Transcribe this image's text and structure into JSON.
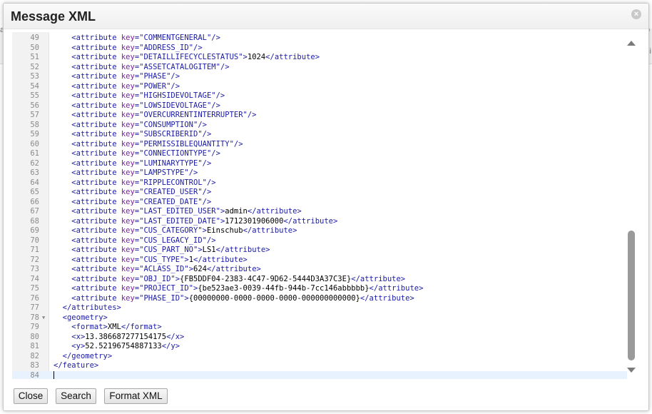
{
  "background": {
    "edge_left": "a",
    "edge_right_top": "o",
    "edge_right_bottom": "si"
  },
  "dialog": {
    "title": "Message XML",
    "close_glyph": "×"
  },
  "lines": [
    {
      "n": "49",
      "indent": "    ",
      "key": "COMMENTGENERAL",
      "value": null
    },
    {
      "n": "50",
      "indent": "    ",
      "key": "ADDRESS_ID",
      "value": null
    },
    {
      "n": "51",
      "indent": "    ",
      "key": "DETAILLIFECYCLESTATUS",
      "value": "1024"
    },
    {
      "n": "52",
      "indent": "    ",
      "key": "ASSETCATALOGITEM",
      "value": null
    },
    {
      "n": "53",
      "indent": "    ",
      "key": "PHASE",
      "value": null
    },
    {
      "n": "54",
      "indent": "    ",
      "key": "POWER",
      "value": null
    },
    {
      "n": "55",
      "indent": "    ",
      "key": "HIGHSIDEVOLTAGE",
      "value": null
    },
    {
      "n": "56",
      "indent": "    ",
      "key": "LOWSIDEVOLTAGE",
      "value": null
    },
    {
      "n": "57",
      "indent": "    ",
      "key": "OVERCURRENTINTERRUPTER",
      "value": null
    },
    {
      "n": "58",
      "indent": "    ",
      "key": "CONSUMPTION",
      "value": null
    },
    {
      "n": "59",
      "indent": "    ",
      "key": "SUBSCRIBERID",
      "value": null
    },
    {
      "n": "60",
      "indent": "    ",
      "key": "PERMISSIBLEQUANTITY",
      "value": null
    },
    {
      "n": "61",
      "indent": "    ",
      "key": "CONNECTIONTYPE",
      "value": null
    },
    {
      "n": "62",
      "indent": "    ",
      "key": "LUMINARYTYPE",
      "value": null
    },
    {
      "n": "63",
      "indent": "    ",
      "key": "LAMPSTYPE",
      "value": null
    },
    {
      "n": "64",
      "indent": "    ",
      "key": "RIPPLECONTROL",
      "value": null
    },
    {
      "n": "65",
      "indent": "    ",
      "key": "CREATED_USER",
      "value": null
    },
    {
      "n": "66",
      "indent": "    ",
      "key": "CREATED_DATE",
      "value": null
    },
    {
      "n": "67",
      "indent": "    ",
      "key": "LAST_EDITED_USER",
      "value": "admin"
    },
    {
      "n": "68",
      "indent": "    ",
      "key": "LAST_EDITED_DATE",
      "value": "1712301906000"
    },
    {
      "n": "69",
      "indent": "    ",
      "key": "CUS_CATEGORY",
      "value": "Einschub"
    },
    {
      "n": "70",
      "indent": "    ",
      "key": "CUS_LEGACY_ID",
      "value": null
    },
    {
      "n": "71",
      "indent": "    ",
      "key": "CUS_PART_NO",
      "value": "LS1"
    },
    {
      "n": "72",
      "indent": "    ",
      "key": "CUS_TYPE",
      "value": "1"
    },
    {
      "n": "73",
      "indent": "    ",
      "key": "ACLASS_ID",
      "value": "624"
    },
    {
      "n": "74",
      "indent": "    ",
      "key": "OBJ_ID",
      "value": "{FB5DDF04-2383-4C47-9D62-5444D3A37C3E}"
    },
    {
      "n": "75",
      "indent": "    ",
      "key": "PROJECT_ID",
      "value": "{be523ae3-0039-44fb-944b-7cc146abbbbb}"
    },
    {
      "n": "76",
      "indent": "    ",
      "key": "PHASE_ID",
      "value": "{00000000-0000-0000-0000-000000000000}"
    }
  ],
  "tail_lines": [
    {
      "n": "77",
      "text": "  </attributes>"
    },
    {
      "n": "78",
      "text": "  <geometry>",
      "fold": true
    },
    {
      "n": "79",
      "text": "    <format>XML</format>"
    },
    {
      "n": "80",
      "text": "    <x>13.386687277154175</x>"
    },
    {
      "n": "81",
      "text": "    <y>52.52196754887133</y>"
    },
    {
      "n": "82",
      "text": "  </geometry>"
    },
    {
      "n": "83",
      "text": "</feature>"
    },
    {
      "n": "84",
      "text": "",
      "active": true
    }
  ],
  "buttons": {
    "close": "Close",
    "search": "Search",
    "format": "Format XML"
  },
  "colors": {
    "tag": "#1a1aa6",
    "attr": "#7a1fa2",
    "text": "#000000",
    "active_line": "#e8f2fe"
  }
}
